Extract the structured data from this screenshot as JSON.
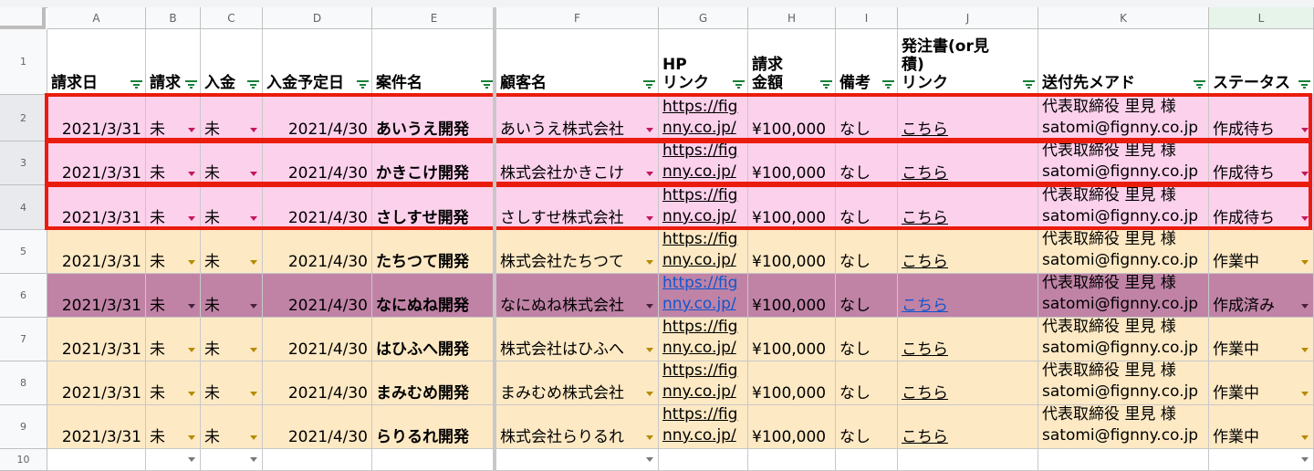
{
  "columns": [
    "A",
    "B",
    "C",
    "D",
    "E",
    "F",
    "G",
    "H",
    "I",
    "J",
    "K",
    "L"
  ],
  "row_numbers": [
    "1",
    "2",
    "3",
    "4",
    "5",
    "6",
    "7",
    "8",
    "9",
    "10"
  ],
  "headers": {
    "A": "請求日",
    "B": "請求",
    "C": "入金",
    "D": "入金予定日",
    "E": "案件名",
    "F": "顧客名",
    "G": "HP\nリンク",
    "H": "請求\n金額",
    "I": "備考",
    "J": "発注書(or見\n積)\nリンク",
    "K": "送付先メアド",
    "L": "ステータス"
  },
  "rows": [
    {
      "date": "2021/3/31",
      "invoice": "未",
      "payment": "未",
      "due": "2021/4/30",
      "project": "あいうえ開発",
      "client": "あいうえ株式会社",
      "hp": "https://fig\nnny.co.jp/",
      "amount": "¥100,000",
      "note": "なし",
      "order_link": "こちら",
      "email": "代表取締役 里見 様\nsatomi@fignny.co.jp",
      "status": "作成待ち",
      "color": "pink"
    },
    {
      "date": "2021/3/31",
      "invoice": "未",
      "payment": "未",
      "due": "2021/4/30",
      "project": "かきこけ開発",
      "client": "株式会社かきこけ",
      "hp": "https://fig\nnny.co.jp/",
      "amount": "¥100,000",
      "note": "なし",
      "order_link": "こちら",
      "email": "代表取締役 里見 様\nsatomi@fignny.co.jp",
      "status": "作成待ち",
      "color": "pink"
    },
    {
      "date": "2021/3/31",
      "invoice": "未",
      "payment": "未",
      "due": "2021/4/30",
      "project": "さしすせ開発",
      "client": "さしすせ株式会社",
      "hp": "https://fig\nnny.co.jp/",
      "amount": "¥100,000",
      "note": "なし",
      "order_link": "こちら",
      "email": "代表取締役 里見 様\nsatomi@fignny.co.jp",
      "status": "作成待ち",
      "color": "pink"
    },
    {
      "date": "2021/3/31",
      "invoice": "未",
      "payment": "未",
      "due": "2021/4/30",
      "project": "たちつて開発",
      "client": "株式会社たちつて",
      "hp": "https://fig\nnny.co.jp/",
      "amount": "¥100,000",
      "note": "なし",
      "order_link": "こちら",
      "email": "代表取締役 里見 様\nsatomi@fignny.co.jp",
      "status": "作業中",
      "color": "yellow"
    },
    {
      "date": "2021/3/31",
      "invoice": "未",
      "payment": "未",
      "due": "2021/4/30",
      "project": "なにぬね開発",
      "client": "なにぬね株式会社",
      "hp": "https://fig\nnny.co.jp/",
      "amount": "¥100,000",
      "note": "なし",
      "order_link": "こちら",
      "email": "代表取締役 里見 様\nsatomi@fignny.co.jp",
      "status": "作成済み",
      "color": "mauve"
    },
    {
      "date": "2021/3/31",
      "invoice": "未",
      "payment": "未",
      "due": "2021/4/30",
      "project": "はひふへ開発",
      "client": "株式会社はひふへ",
      "hp": "https://fig\nnny.co.jp/",
      "amount": "¥100,000",
      "note": "なし",
      "order_link": "こちら",
      "email": "代表取締役 里見 様\nsatomi@fignny.co.jp",
      "status": "作業中",
      "color": "yellow"
    },
    {
      "date": "2021/3/31",
      "invoice": "未",
      "payment": "未",
      "due": "2021/4/30",
      "project": "まみむめ開発",
      "client": "まみむめ株式会社",
      "hp": "https://fig\nnny.co.jp/",
      "amount": "¥100,000",
      "note": "なし",
      "order_link": "こちら",
      "email": "代表取締役 里見 様\nsatomi@fignny.co.jp",
      "status": "作業中",
      "color": "yellow"
    },
    {
      "date": "2021/3/31",
      "invoice": "未",
      "payment": "未",
      "due": "2021/4/30",
      "project": "らりるれ開発",
      "client": "株式会社らりるれ",
      "hp": "https://fig\nnny.co.jp/",
      "amount": "¥100,000",
      "note": "なし",
      "order_link": "こちら",
      "email": "代表取締役 里見 様\nsatomi@fignny.co.jp",
      "status": "作業中",
      "color": "yellow"
    }
  ],
  "colors": {
    "pink": "#fcd1ec",
    "yellow": "#fde9c4",
    "mauve": "#c083a6",
    "highlight": "#ea1c0d",
    "filter_green": "#188038"
  }
}
